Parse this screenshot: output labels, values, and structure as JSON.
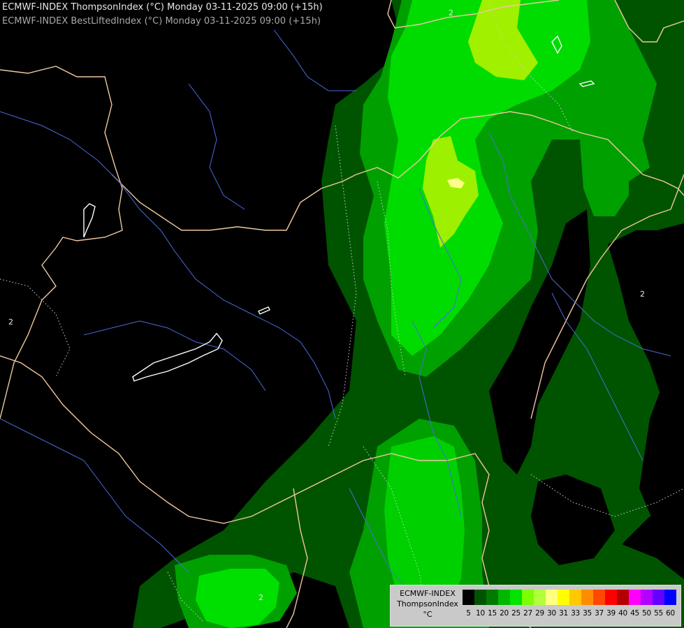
{
  "title": {
    "line1": "ECMWF-INDEX ThompsonIndex (°C) Monday 03-11-2025 09:00 (+15h)",
    "line2": "ECMWF-INDEX BestLiftedIndex (°C) Monday 03-11-2025 09:00 (+15h)"
  },
  "legend": {
    "line1": "ECMWF-INDEX",
    "line2": "ThompsonIndex",
    "line3": "°C",
    "values": [
      "5",
      "10",
      "15",
      "20",
      "25",
      "27",
      "29",
      "30",
      "31",
      "33",
      "35",
      "37",
      "39",
      "40",
      "45",
      "50",
      "55",
      "60"
    ],
    "colors": [
      "#000000",
      "#000000",
      "#000000",
      "#000000",
      "#004d00",
      "#006e00",
      "#00b000",
      "#00e000",
      "#7cff00",
      "#b4ff3c",
      "#ffff80",
      "#ffff00",
      "#ffcc00",
      "#ff8c00",
      "#ff5000",
      "#ff0000",
      "#b40000",
      "#ff00ff",
      "#b400ff",
      "#6400ff",
      "#0000ff"
    ]
  },
  "map": {
    "fill_colors": {
      "dark_green": "#004d00",
      "mid_green": "#00a000",
      "bright_green": "#00d800",
      "lime": "#80ff00",
      "yellow_green": "#b4ff3c",
      "pale_yellow": "#ffff80"
    },
    "border_color": "#f0c8a0",
    "river_color": "#4a6ad8",
    "lifted_index_labels": [
      "2",
      "2",
      "2",
      "2"
    ]
  }
}
